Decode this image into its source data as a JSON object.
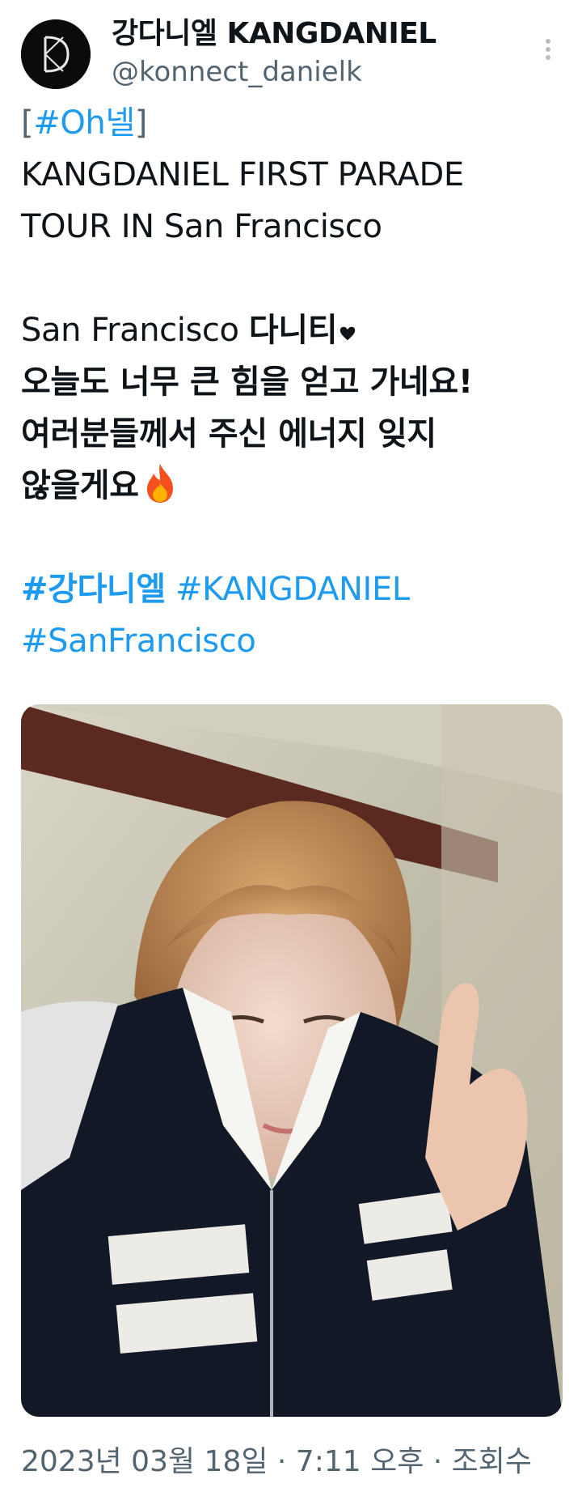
{
  "author": {
    "display_name": "강다니엘 KANGDANIEL",
    "handle": "@konnect_danielk"
  },
  "tweet": {
    "hashtag_open": "[",
    "hashtag_oh": "#Oh넬",
    "hashtag_close": "]",
    "title_line1": "KANGDANIEL FIRST PARADE",
    "title_line2": "TOUR IN San Francisco",
    "message_line1_en": "San Francisco ",
    "message_line1_kr": "다니티",
    "message_line2": "오늘도 너무 큰 힘을 얻고 가네요!",
    "message_line3": "여러분들께서 주신 에너지 잊지",
    "message_line4": "않을게요",
    "tag_kangdaniel_kr": "#강다니엘",
    "tag_kangdaniel_en": "#KANGDANIEL",
    "tag_sanfrancisco": "#SanFrancisco"
  },
  "meta": {
    "timestamp": "2023년 03월 18일 · 7:11 오후 · 조회수"
  },
  "colors": {
    "link": "#1d9bf0",
    "secondary_text": "#536471",
    "primary_text": "#0f1419"
  },
  "icons": {
    "more": "more-vertical-icon",
    "heart": "heart-icon",
    "fire": "fire-icon"
  }
}
